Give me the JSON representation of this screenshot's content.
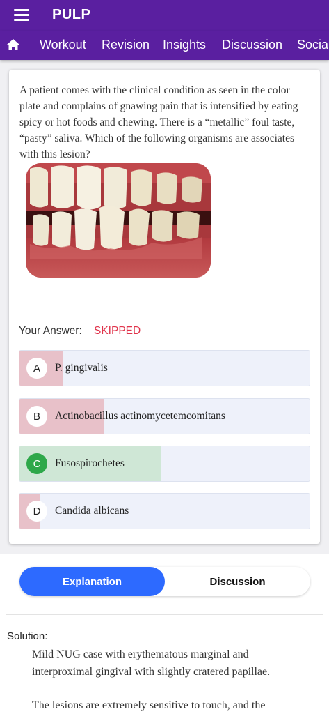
{
  "app": {
    "title": "PULP"
  },
  "nav": {
    "tabs": [
      "Workout",
      "Revision",
      "Insights",
      "Discussion",
      "Social"
    ]
  },
  "question": {
    "text": "A patient comes with the clinical condition as seen in the color plate and complains of gnawing pain that is intensified by eating spicy or hot foods and chewing. There is a “metallic” foul taste, “pasty” saliva. Which of the following organisms are associates with this lesion?"
  },
  "answer": {
    "label": "Your Answer:",
    "status": "SKIPPED"
  },
  "options": [
    {
      "letter": "A",
      "text": "P. gingivalis",
      "fill_fraction": 0.15,
      "fill_color": "#e8c1c9",
      "correct": false
    },
    {
      "letter": "B",
      "text": "Actinobacillus actinomycetemcomitans",
      "fill_fraction": 0.29,
      "fill_color": "#e8c1c9",
      "correct": false
    },
    {
      "letter": "C",
      "text": "Fusospirochetes",
      "fill_fraction": 0.49,
      "fill_color": "#cfe7d6",
      "correct": true
    },
    {
      "letter": "D",
      "text": "Candida albicans",
      "fill_fraction": 0.07,
      "fill_color": "#e8c1c9",
      "correct": false
    }
  ],
  "toggle": {
    "explanation": "Explanation",
    "discussion": "Discussion"
  },
  "solution": {
    "label": "Solution:",
    "p1": "Mild NUG case with erythematous marginal and interproximal gingival with slightly cratered papillae.",
    "p2": "The lesions are extremely sensitive to touch, and the"
  },
  "colors": {
    "primary": "#5a1fa0",
    "accent": "#2d6aff",
    "skipped": "#e0334b",
    "correct": "#2ea84a"
  }
}
